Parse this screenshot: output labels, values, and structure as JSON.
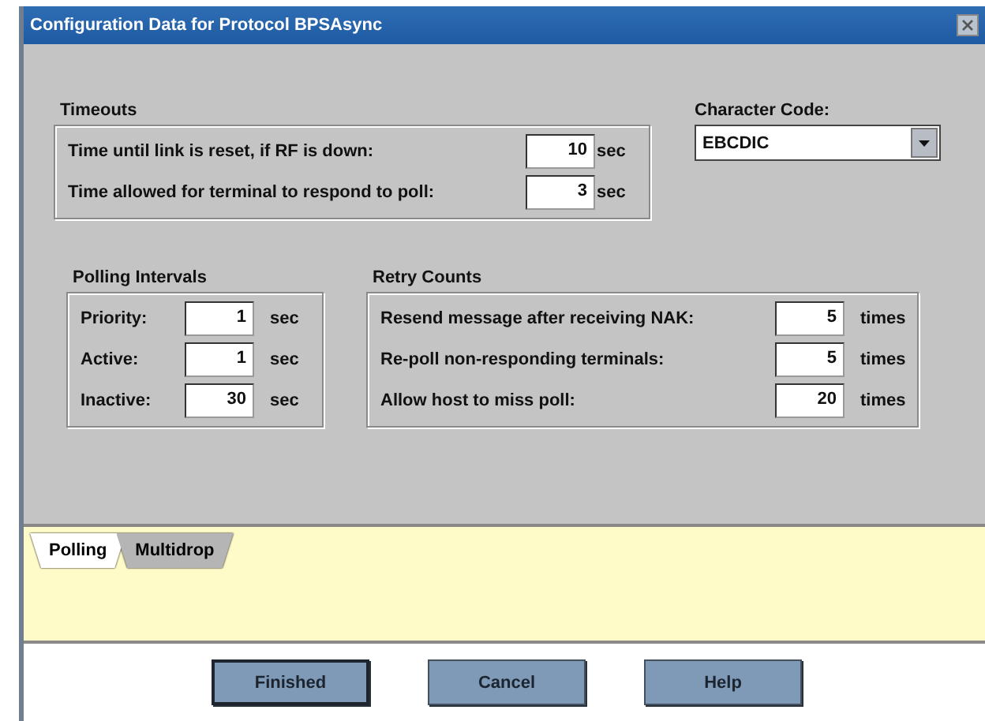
{
  "window": {
    "title": "Configuration Data for Protocol BPSAsync"
  },
  "timeouts": {
    "label": "Timeouts",
    "rows": [
      {
        "label": "Time until link is reset, if RF is down:",
        "value": "10",
        "unit": "sec"
      },
      {
        "label": "Time allowed for terminal to respond to poll:",
        "value": "3",
        "unit": "sec"
      }
    ]
  },
  "character_code": {
    "label": "Character Code:",
    "value": "EBCDIC"
  },
  "polling_intervals": {
    "label": "Polling Intervals",
    "rows": [
      {
        "label": "Priority:",
        "value": "1",
        "unit": "sec"
      },
      {
        "label": "Active:",
        "value": "1",
        "unit": "sec"
      },
      {
        "label": "Inactive:",
        "value": "30",
        "unit": "sec"
      }
    ]
  },
  "retry_counts": {
    "label": "Retry Counts",
    "rows": [
      {
        "label": "Resend message after receiving NAK:",
        "value": "5",
        "unit": "times"
      },
      {
        "label": "Re-poll non-responding terminals:",
        "value": "5",
        "unit": "times"
      },
      {
        "label": "Allow host to miss poll:",
        "value": "20",
        "unit": "times"
      }
    ]
  },
  "tabs": [
    {
      "label": "Polling",
      "selected": true
    },
    {
      "label": "Multidrop",
      "selected": false
    }
  ],
  "buttons": [
    {
      "label": "Finished",
      "default": true
    },
    {
      "label": "Cancel",
      "default": false
    },
    {
      "label": "Help",
      "default": false
    }
  ]
}
